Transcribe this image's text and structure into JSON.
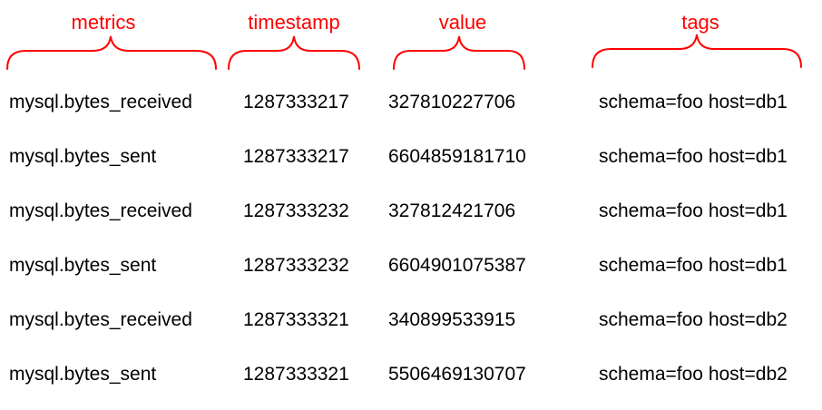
{
  "accent_color": "#ff0000",
  "headers": {
    "metrics": "metrics",
    "timestamp": "timestamp",
    "value": "value",
    "tags": "tags"
  },
  "rows": [
    {
      "metric": "mysql.bytes_received",
      "timestamp": "1287333217",
      "value": "327810227706",
      "tags": "schema=foo host=db1"
    },
    {
      "metric": "mysql.bytes_sent",
      "timestamp": "1287333217",
      "value": "6604859181710",
      "tags": "schema=foo host=db1"
    },
    {
      "metric": "mysql.bytes_received",
      "timestamp": "1287333232",
      "value": "327812421706",
      "tags": "schema=foo host=db1"
    },
    {
      "metric": "mysql.bytes_sent",
      "timestamp": "1287333232",
      "value": "6604901075387",
      "tags": "schema=foo host=db1"
    },
    {
      "metric": "mysql.bytes_received",
      "timestamp": "1287333321",
      "value": "340899533915",
      "tags": "schema=foo host=db2"
    },
    {
      "metric": "mysql.bytes_sent",
      "timestamp": "1287333321",
      "value": "5506469130707",
      "tags": "schema=foo host=db2"
    }
  ]
}
